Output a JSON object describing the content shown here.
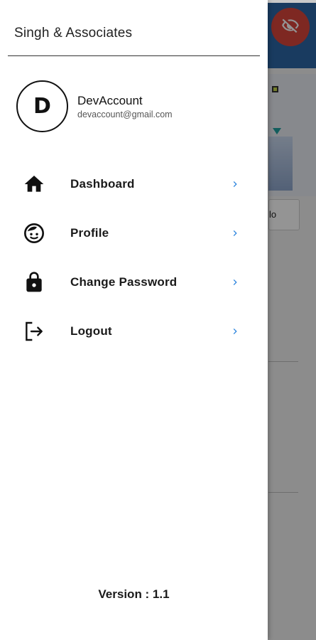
{
  "drawer": {
    "title": "Singh & Associates",
    "user": {
      "avatar_initial": "D",
      "name": "DevAccount",
      "email": "devaccount@gmail.com"
    },
    "menu": [
      {
        "label": "Dashboard",
        "icon": "home-icon"
      },
      {
        "label": "Profile",
        "icon": "profile-face-icon"
      },
      {
        "label": "Change Password",
        "icon": "lock-icon"
      },
      {
        "label": "Logout",
        "icon": "logout-icon"
      }
    ],
    "version": "Version : 1.1"
  },
  "background": {
    "fab_icon": "eye-off-icon",
    "button_fragment": "lo"
  },
  "colors": {
    "chevron": "#2e86de",
    "fab": "#d9463b",
    "drawer_bg": "#ffffff"
  }
}
